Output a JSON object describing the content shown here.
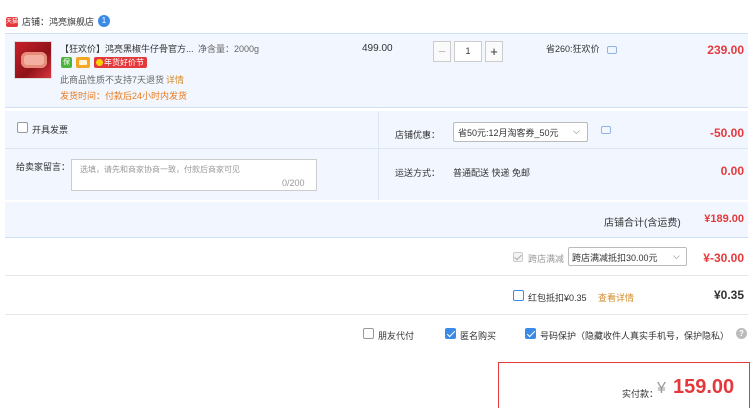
{
  "shop": {
    "icon_text": "天猫",
    "label": "店铺：鸿亮旗舰店",
    "chat_icon_text": "1"
  },
  "item": {
    "title": "【狂欢价】鸿亮黑椒牛仔骨官方...",
    "spec": "净含量：2000g",
    "badges": {
      "green": "保",
      "festival": "年货好价节"
    },
    "note": "此商品性质不支持7天退货",
    "note_link": "详情",
    "delivery": "发货时间：付款后24小时内发货",
    "unit_price": "499.00",
    "quantity": "1",
    "qty_minus": "−",
    "qty_plus": "+",
    "saving": "省260:狂欢价",
    "total": "239.00"
  },
  "form": {
    "invoice_label": "开具发票",
    "message_label": "给卖家留言：",
    "message_placeholder": "选填，请先和商家协商一致，付款后商家可见",
    "message_count": "0/200",
    "coupon_label": "店铺优惠：",
    "coupon_selected": "省50元:12月淘客券_50元",
    "coupon_amount": "-50.00",
    "shipping_label": "运送方式：",
    "shipping_value": "普通配送 快递 免邮",
    "shipping_amount": "0.00"
  },
  "subtotal": {
    "label": "店铺合计(含运费)",
    "value": "¥189.00"
  },
  "cross_store": {
    "label": "跨店满减",
    "selected": "跨店满减抵扣30.00元",
    "amount": "¥-30.00"
  },
  "red_packet": {
    "label": "红包抵扣¥0.35",
    "link": "查看详情",
    "amount": "¥0.35"
  },
  "options": {
    "friend_pay": {
      "label": "朋友代付",
      "checked": false
    },
    "anonymous": {
      "label": "匿名购买",
      "checked": true
    },
    "privacy": {
      "label": "号码保护（隐藏收件人真实手机号，保护隐私）",
      "checked": true
    },
    "help_icon_text": "?"
  },
  "payment": {
    "label": "实付款：",
    "currency": "¥",
    "amount": "159.00"
  },
  "colors": {
    "accent_red": "#e4393c",
    "accent_blue": "#3b8ae8",
    "panel_bg": "#f2f7ff",
    "link_orange": "#d58b2a"
  }
}
